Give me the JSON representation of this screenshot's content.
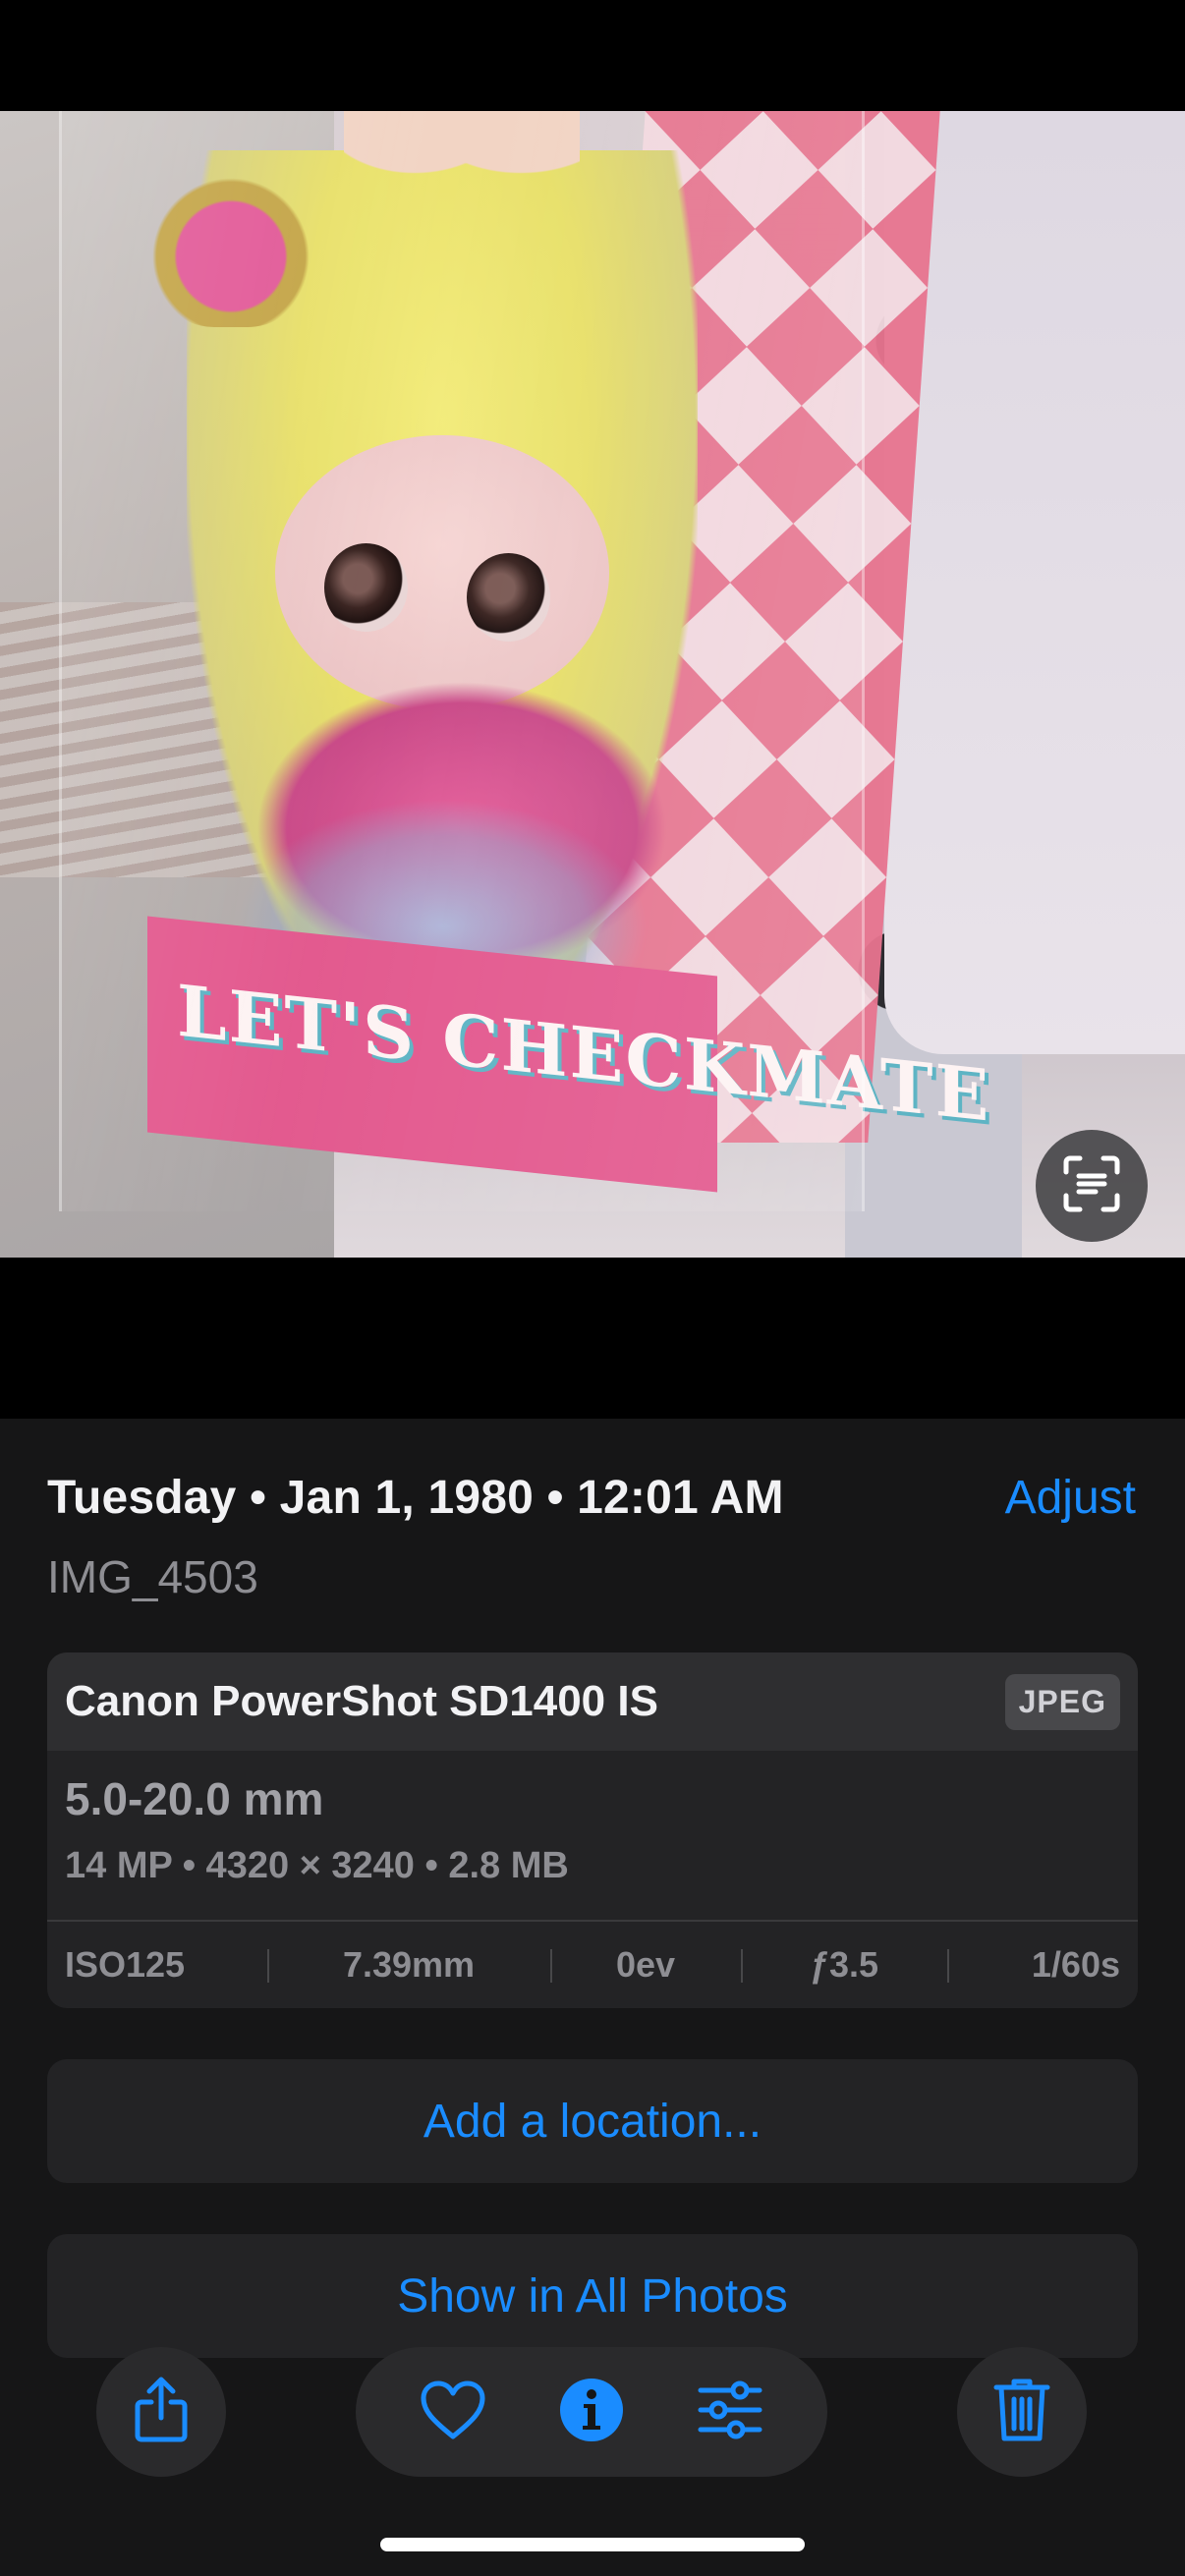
{
  "photo": {
    "box_text": "LET'S CHECKMATE"
  },
  "info": {
    "date_line": "Tuesday • Jan 1, 1980 • 12:01 AM",
    "adjust_label": "Adjust",
    "filename": "IMG_4503"
  },
  "exif": {
    "camera": "Canon PowerShot SD1400 IS",
    "format": "JPEG",
    "lens": "5.0-20.0 mm",
    "specs": "14 MP • 4320 × 3240 • 2.8 MB",
    "iso": "ISO125",
    "focal_length": "7.39mm",
    "exposure_bias": "0ev",
    "aperture": "ƒ3.5",
    "shutter": "1/60s"
  },
  "actions": {
    "add_location": "Add a location...",
    "show_all_photos": "Show in All Photos"
  },
  "toolbar": {
    "icons": [
      "share-icon",
      "heart-icon",
      "info-icon",
      "adjust-sliders-icon",
      "trash-icon"
    ],
    "accent_color": "#1a8cff"
  }
}
